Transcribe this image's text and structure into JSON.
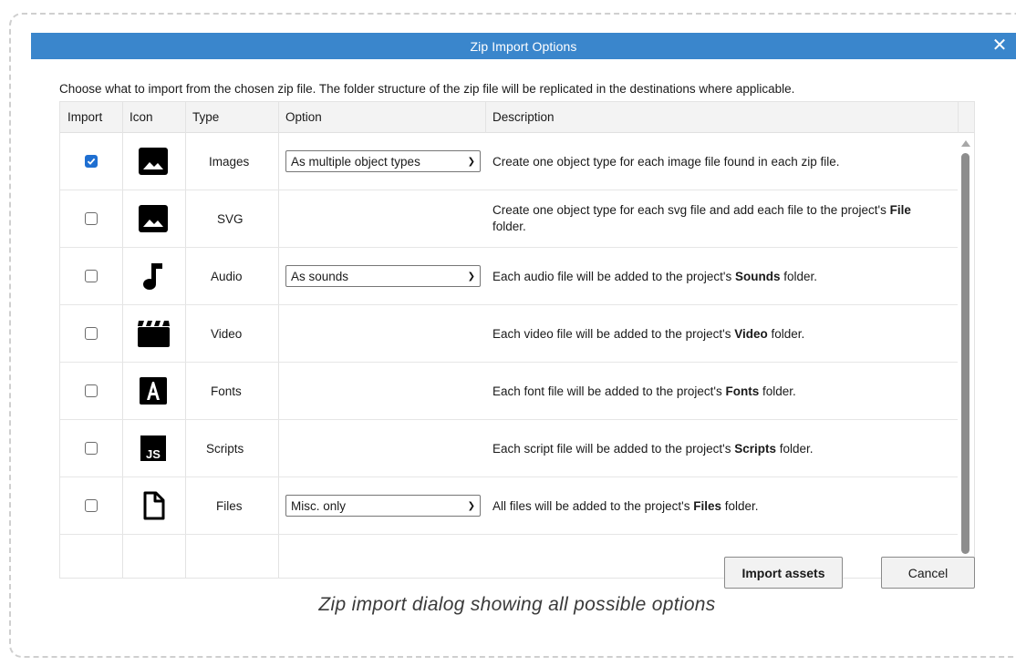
{
  "dialog": {
    "title": "Zip Import Options",
    "close_glyph": "✕",
    "intro": "Choose what to import from the chosen zip file. The folder structure of the zip file will be replicated in the destinations where applicable."
  },
  "table": {
    "headers": {
      "import": "Import",
      "icon": "Icon",
      "type": "Type",
      "option": "Option",
      "description": "Description"
    },
    "rows": [
      {
        "checked": true,
        "icon": "image-icon",
        "type": "Images",
        "option": "As multiple object types",
        "desc_pre": "Create one object type for each image file found in each zip file.",
        "desc_bold": "",
        "desc_post": ""
      },
      {
        "checked": false,
        "icon": "image-icon",
        "type": "SVG",
        "option": "",
        "desc_pre": "Create one object type for each svg file and add each file to the project's ",
        "desc_bold": "File",
        "desc_post": " folder."
      },
      {
        "checked": false,
        "icon": "music-note-icon",
        "type": "Audio",
        "option": "As sounds",
        "desc_pre": "Each audio file will be added to the project's ",
        "desc_bold": "Sounds",
        "desc_post": " folder."
      },
      {
        "checked": false,
        "icon": "clapperboard-icon",
        "type": "Video",
        "option": "",
        "desc_pre": "Each video file will be added to the project's ",
        "desc_bold": "Video",
        "desc_post": " folder."
      },
      {
        "checked": false,
        "icon": "font-icon",
        "type": "Fonts",
        "option": "",
        "desc_pre": "Each font file will be added to the project's ",
        "desc_bold": "Fonts",
        "desc_post": " folder."
      },
      {
        "checked": false,
        "icon": "javascript-icon",
        "type": "Scripts",
        "option": "",
        "desc_pre": "Each script file will be added to the project's ",
        "desc_bold": "Scripts",
        "desc_post": " folder."
      },
      {
        "checked": false,
        "icon": "file-icon",
        "type": "Files",
        "option": "Misc. only",
        "desc_pre": "All files will be added to the project's ",
        "desc_bold": "Files",
        "desc_post": " folder."
      }
    ]
  },
  "buttons": {
    "import_label": "Import assets",
    "cancel_label": "Cancel"
  },
  "caption": "Zip import dialog showing all possible options",
  "colors": {
    "titlebar": "#3a86cc",
    "checkbox_checked": "#1f6fd1"
  }
}
